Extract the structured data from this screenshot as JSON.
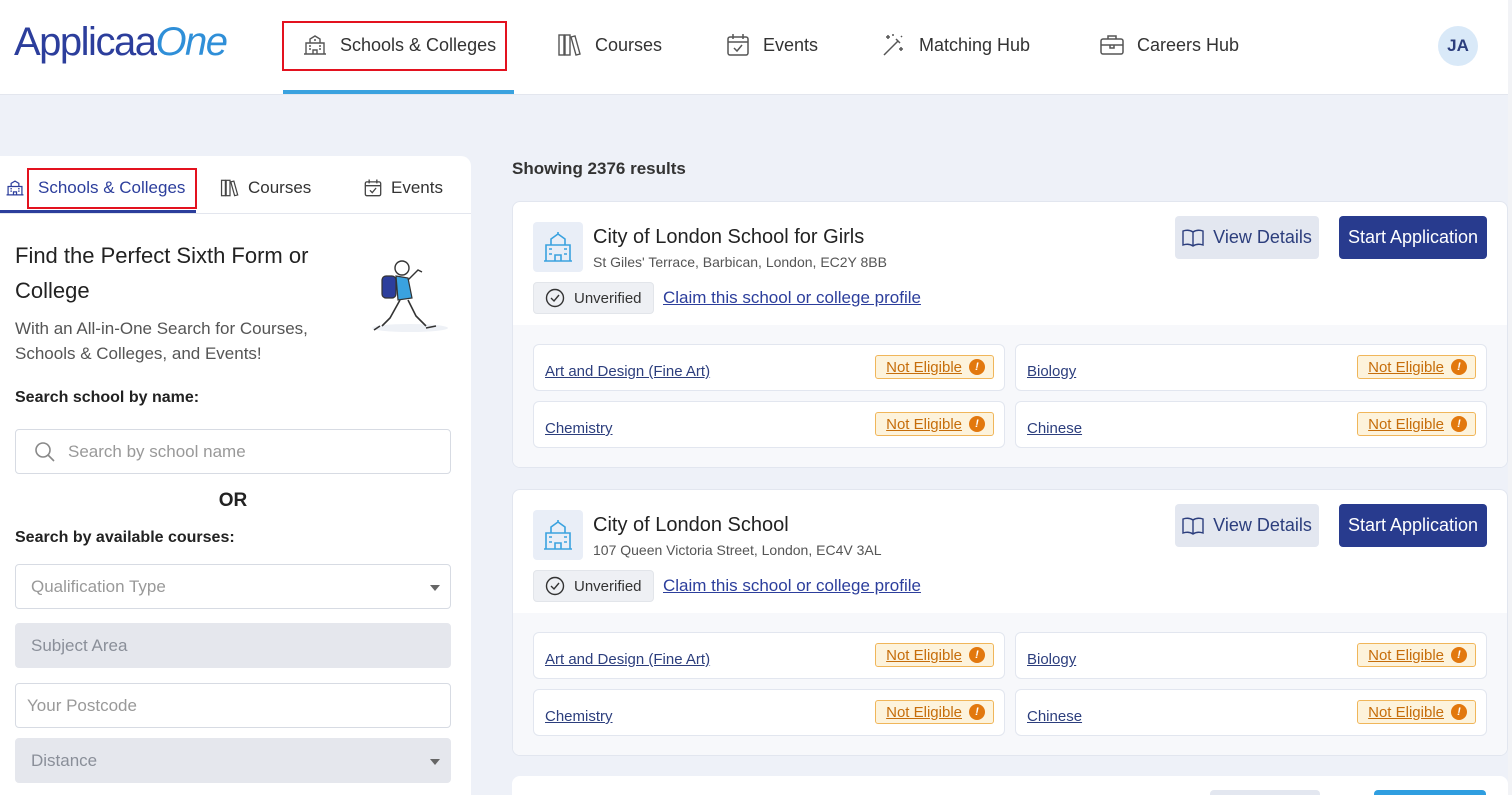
{
  "brand": {
    "name_part1": "Applicaa",
    "name_part2": "One"
  },
  "topnav": {
    "items": [
      {
        "label": "Schools & Colleges",
        "icon": "school-icon"
      },
      {
        "label": "Courses",
        "icon": "books-icon"
      },
      {
        "label": "Events",
        "icon": "calendar-check-icon"
      },
      {
        "label": "Matching Hub",
        "icon": "magic-wand-icon"
      },
      {
        "label": "Careers Hub",
        "icon": "briefcase-icon"
      }
    ],
    "active": "Schools & Colleges",
    "avatar_initials": "JA"
  },
  "sidebar": {
    "tabs": [
      {
        "label": "Schools & Colleges",
        "icon": "school-icon"
      },
      {
        "label": "Courses",
        "icon": "books-icon"
      },
      {
        "label": "Events",
        "icon": "calendar-check-icon"
      }
    ],
    "active_tab": "Schools & Colleges",
    "title": "Find the Perfect Sixth Form or College",
    "subtitle": "With an All-in-One Search for Courses, Schools & Colleges, and Events!",
    "search_label": "Search school by name:",
    "search_placeholder": "Search by school name",
    "or_text": "OR",
    "courses_label": "Search by available courses:",
    "qualification_placeholder": "Qualification Type",
    "subject_placeholder": "Subject Area",
    "postcode_placeholder": "Your Postcode",
    "distance_placeholder": "Distance"
  },
  "results": {
    "count_text": "Showing 2376 results",
    "view_details_label": "View Details",
    "start_application_label": "Start Application",
    "unverified_label": "Unverified",
    "claim_label": "Claim this school or college profile",
    "cards": [
      {
        "name": "City of London School for Girls",
        "address": "St Giles' Terrace, Barbican, London, EC2Y 8BB",
        "courses": [
          {
            "name": "Art and Design (Fine Art)",
            "status": "Not Eligible"
          },
          {
            "name": "Biology",
            "status": "Not Eligible"
          },
          {
            "name": "Chemistry",
            "status": "Not Eligible"
          },
          {
            "name": "Chinese",
            "status": "Not Eligible"
          }
        ]
      },
      {
        "name": "City of London School",
        "address": "107 Queen Victoria Street, London, EC4V 3AL",
        "courses": [
          {
            "name": "Art and Design (Fine Art)",
            "status": "Not Eligible"
          },
          {
            "name": "Biology",
            "status": "Not Eligible"
          },
          {
            "name": "Chemistry",
            "status": "Not Eligible"
          },
          {
            "name": "Chinese",
            "status": "Not Eligible"
          }
        ]
      }
    ]
  },
  "colors": {
    "brand_primary": "#283b8e",
    "brand_accent": "#3aa2df",
    "highlight_box": "#e3121f",
    "warning": "#e2780e"
  }
}
